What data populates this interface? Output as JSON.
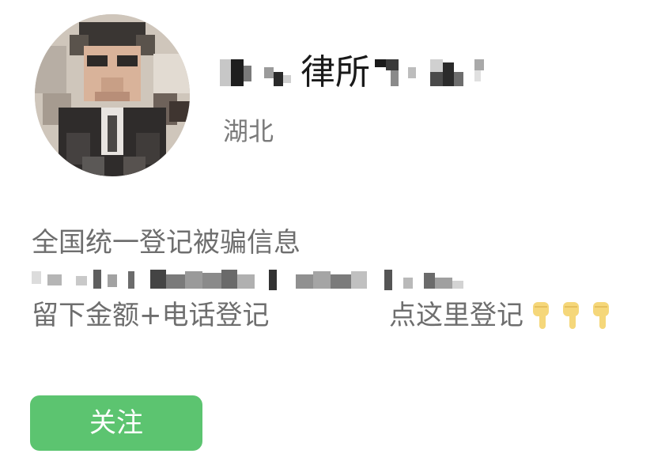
{
  "profile": {
    "name_visible": "律所",
    "location": "湖北"
  },
  "bio": {
    "line1": "全国统一登记被骗信息",
    "line3_left": "留下金额+电话登记",
    "line3_right": "点这里登记"
  },
  "actions": {
    "follow_label": "关注"
  },
  "icons": {
    "avatar": "pixelated-person-photo",
    "pointer": "pointing-down-hand-emoji"
  },
  "colors": {
    "follow_button": "#5cc470",
    "text_primary": "#1a1a1a",
    "text_secondary": "#6e6e6e",
    "hand_emoji": "#f5d77a"
  }
}
